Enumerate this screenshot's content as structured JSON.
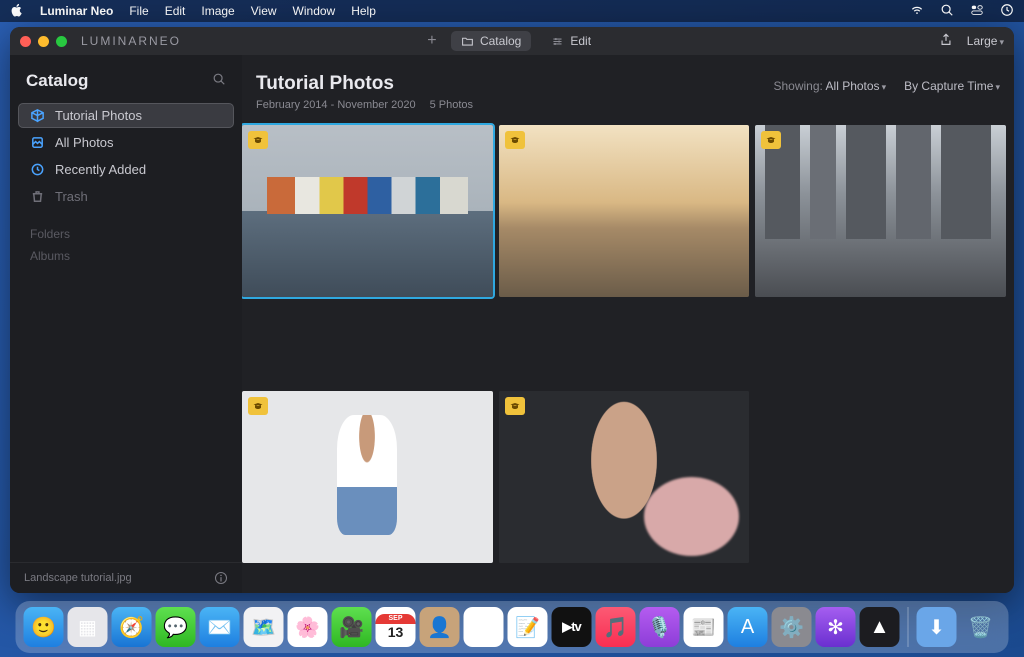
{
  "menubar": {
    "app": "Luminar Neo",
    "items": [
      "File",
      "Edit",
      "Image",
      "View",
      "Window",
      "Help"
    ]
  },
  "titlebar": {
    "logo": "LUMINARNEO",
    "tabs": {
      "catalog": "Catalog",
      "edit": "Edit"
    },
    "size_label": "Large"
  },
  "sidebar": {
    "header": "Catalog",
    "items": [
      {
        "label": "Tutorial Photos",
        "icon": "cube"
      },
      {
        "label": "All Photos",
        "icon": "photos"
      },
      {
        "label": "Recently Added",
        "icon": "clock"
      },
      {
        "label": "Trash",
        "icon": "trash"
      }
    ],
    "sections": [
      "Folders",
      "Albums"
    ],
    "footer_file": "Landscape tutorial.jpg"
  },
  "main": {
    "title": "Tutorial Photos",
    "date_range": "February 2014 - November 2020",
    "count_label": "5 Photos",
    "showing_label": "Showing:",
    "showing_value": "All Photos",
    "sort_label": "By Capture Time"
  },
  "dock": {
    "items": [
      {
        "name": "finder",
        "bg": "linear-gradient(#4ab4f5,#1e7fe0)",
        "glyph": "🙂"
      },
      {
        "name": "launchpad",
        "bg": "#e6e6ea",
        "glyph": "▦"
      },
      {
        "name": "safari",
        "bg": "linear-gradient(#4bb4f4,#1874d4)",
        "glyph": "🧭"
      },
      {
        "name": "messages",
        "bg": "linear-gradient(#5ee04f,#2fb723)",
        "glyph": "💬"
      },
      {
        "name": "mail",
        "bg": "linear-gradient(#4ab4f5,#1e7fe0)",
        "glyph": "✉️"
      },
      {
        "name": "maps",
        "bg": "#f2f2f4",
        "glyph": "🗺️"
      },
      {
        "name": "photos",
        "bg": "#fff",
        "glyph": "🌸"
      },
      {
        "name": "facetime",
        "bg": "linear-gradient(#5ee04f,#2fb723)",
        "glyph": "🎥"
      },
      {
        "name": "calendar",
        "bg": "#fff",
        "glyph": "13"
      },
      {
        "name": "contacts",
        "bg": "#c7a37a",
        "glyph": "👤"
      },
      {
        "name": "reminders",
        "bg": "#fff",
        "glyph": "☰"
      },
      {
        "name": "notes",
        "bg": "#fff",
        "glyph": "📝"
      },
      {
        "name": "tv",
        "bg": "#111",
        "glyph": "tv"
      },
      {
        "name": "music",
        "bg": "linear-gradient(#fb5a74,#fa2e52)",
        "glyph": "🎵"
      },
      {
        "name": "podcasts",
        "bg": "linear-gradient(#b55cf0,#8d3dd8)",
        "glyph": "🎙️"
      },
      {
        "name": "news",
        "bg": "#fff",
        "glyph": "📰"
      },
      {
        "name": "appstore",
        "bg": "linear-gradient(#4ab4f5,#1e7fe0)",
        "glyph": "A"
      },
      {
        "name": "settings",
        "bg": "#8a8a90",
        "glyph": "⚙️"
      },
      {
        "name": "santa",
        "bg": "linear-gradient(#a55ef0,#6a2fd0)",
        "glyph": "✻"
      },
      {
        "name": "luminar",
        "bg": "#1c1c20",
        "glyph": "▲"
      }
    ],
    "right": [
      {
        "name": "downloads",
        "bg": "#6aa6e8",
        "glyph": "⬇"
      },
      {
        "name": "trash",
        "bg": "transparent",
        "glyph": "🗑️"
      }
    ]
  }
}
